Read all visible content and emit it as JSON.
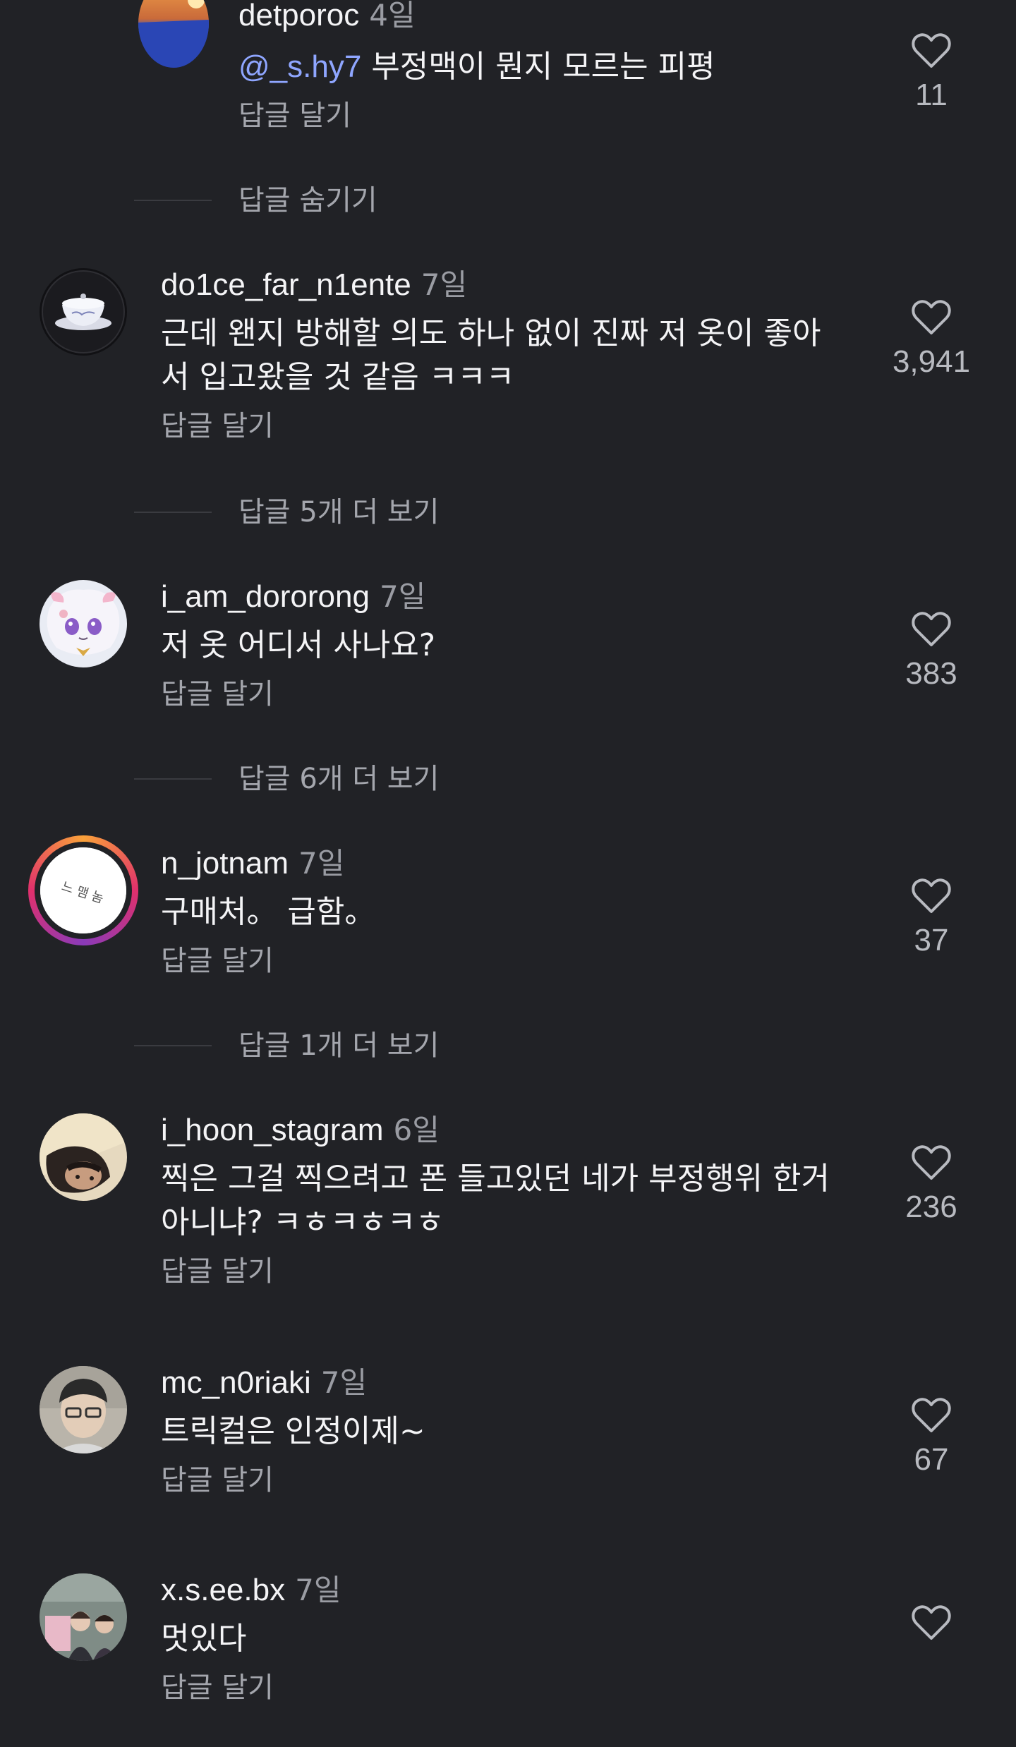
{
  "comments": [
    {
      "username": "detporoc",
      "time": "4일",
      "mention": "@_s.hy7",
      "text": "부정맥이 뭔지 모르는 피평",
      "reply_label": "답글 달기",
      "likes": "11"
    },
    {
      "username": "do1ce_far_n1ente",
      "time": "7일",
      "text": "근데 왠지 방해할 의도 하나 없이 진짜 저 옷이 좋아서 입고왔을 것 같음 ㅋㅋㅋ",
      "reply_label": "답글 달기",
      "likes": "3,941"
    },
    {
      "username": "i_am_dororong",
      "time": "7일",
      "text": "저 옷 어디서 사나요?",
      "reply_label": "답글 달기",
      "likes": "383"
    },
    {
      "username": "n_jotnam",
      "time": "7일",
      "text": "구매처。 급함。",
      "reply_label": "답글 달기",
      "likes": "37"
    },
    {
      "username": "i_hoon_stagram",
      "time": "6일",
      "text": "찍은 그걸 찍으려고 폰 들고있던 네가 부정행위 한거 아니냐? ㅋㅎㅋㅎㅋㅎ",
      "reply_label": "답글 달기",
      "likes": "236"
    },
    {
      "username": "mc_n0riaki",
      "time": "7일",
      "text": "트릭컬은 인정이제~",
      "reply_label": "답글 달기",
      "likes": "67"
    },
    {
      "username": "x.s.ee.bx",
      "time": "7일",
      "text": "멋있다",
      "reply_label": "답글 달기",
      "likes": ""
    }
  ],
  "threads": {
    "hide_replies": "답글 숨기기",
    "more_5": "답글 5개 더 보기",
    "more_6": "답글 6개 더 보기",
    "more_1": "답글 1개 더 보기"
  },
  "avatar_texts": {
    "n_jotnam": "느 맴 놈"
  },
  "colors": {
    "background": "#212226",
    "mention": "#8fa6ff",
    "muted_text": "#a4a6ad"
  },
  "icons": {
    "like": "heart-outline-icon"
  }
}
